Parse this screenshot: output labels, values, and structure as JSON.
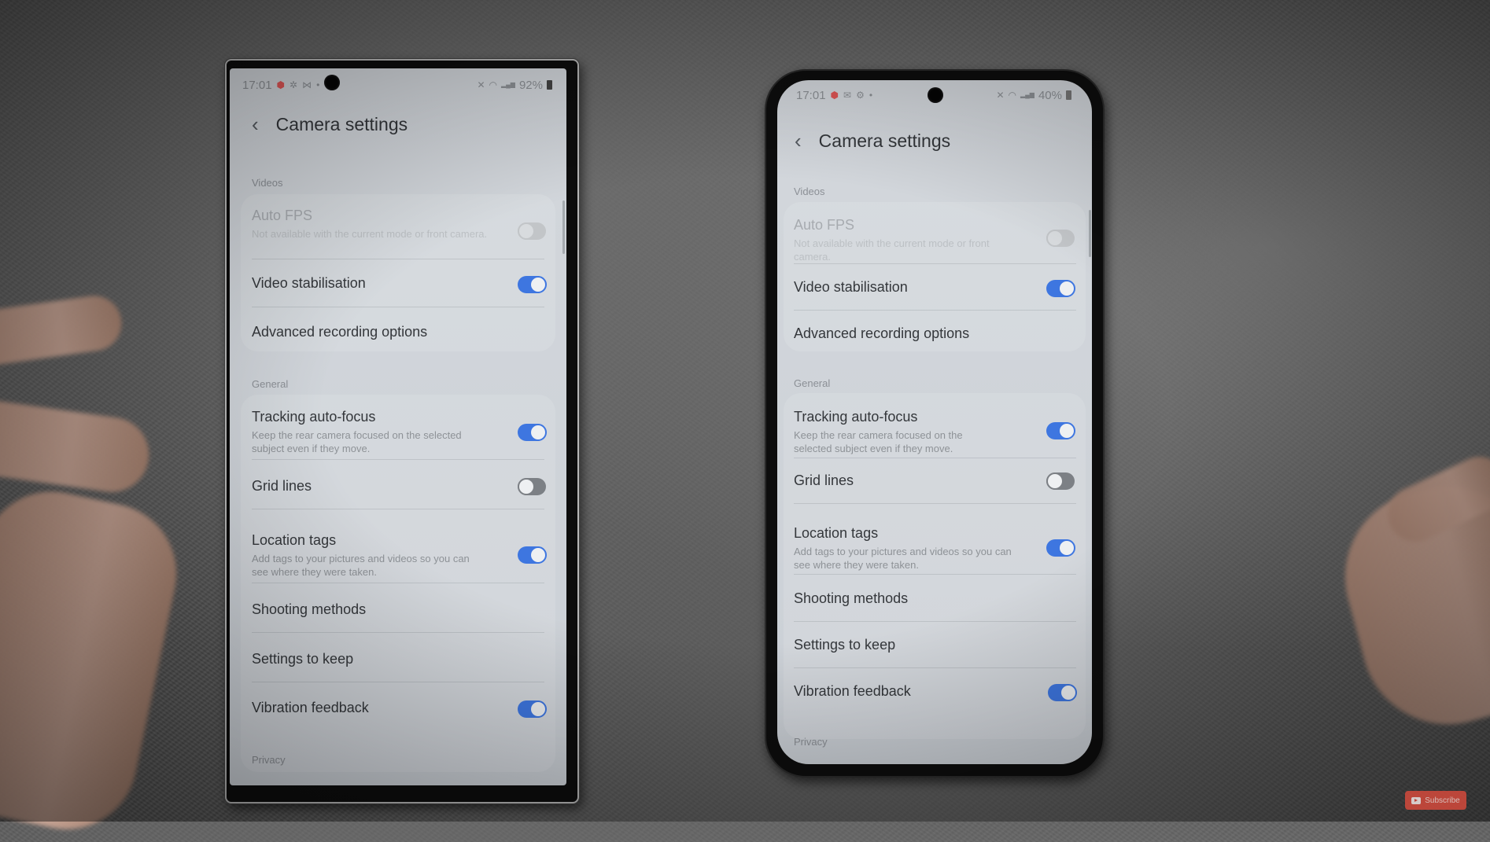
{
  "phones": {
    "left": {
      "status": {
        "time": "17:01",
        "battery": "92%",
        "icons_left": [
          "record-icon",
          "pinwheel-icon",
          "gmail-icon",
          "dot-icon"
        ],
        "icons_right": [
          "mute-icon",
          "wifi-icon",
          "signal-icon",
          "battery-icon"
        ]
      },
      "title": "Camera settings",
      "sections": [
        "Videos",
        "General",
        "Privacy"
      ],
      "items": [
        {
          "label": "Auto FPS",
          "sub": "Not available with the current mode or front camera.",
          "toggle": "disabled"
        },
        {
          "label": "Video stabilisation",
          "toggle": "on"
        },
        {
          "label": "Advanced recording options"
        },
        {
          "label": "Tracking auto-focus",
          "sub": "Keep the rear camera focused on the selected subject even if they move.",
          "toggle": "on"
        },
        {
          "label": "Grid lines",
          "toggle": "off"
        },
        {
          "label": "Location tags",
          "sub": "Add tags to your pictures and videos so you can see where they were taken.",
          "toggle": "on"
        },
        {
          "label": "Shooting methods"
        },
        {
          "label": "Settings to keep"
        },
        {
          "label": "Vibration feedback",
          "toggle": "on"
        }
      ]
    },
    "right": {
      "status": {
        "time": "17:01",
        "battery": "40%",
        "icons_left": [
          "record-icon",
          "mail-icon",
          "gear-icon",
          "dot-icon"
        ],
        "icons_right": [
          "mute-icon",
          "wifi-icon",
          "signal-icon",
          "battery-icon"
        ]
      },
      "title": "Camera settings",
      "sections": [
        "Videos",
        "General",
        "Privacy"
      ],
      "items": [
        {
          "label": "Auto FPS",
          "sub": "Not available with the current mode or front camera.",
          "toggle": "disabled"
        },
        {
          "label": "Video stabilisation",
          "toggle": "on"
        },
        {
          "label": "Advanced recording options"
        },
        {
          "label": "Tracking auto-focus",
          "sub": "Keep the rear camera focused on the selected subject even if they move.",
          "toggle": "on"
        },
        {
          "label": "Grid lines",
          "toggle": "off"
        },
        {
          "label": "Location tags",
          "sub": "Add tags to your pictures and videos so you can see where they were taken.",
          "toggle": "on"
        },
        {
          "label": "Shooting methods"
        },
        {
          "label": "Settings to keep"
        },
        {
          "label": "Vibration feedback",
          "toggle": "on"
        }
      ]
    }
  },
  "overlay": {
    "subscribe_label": "Subscribe"
  },
  "colors": {
    "toggle_on": "#3e76e0",
    "toggle_off": "#7c8085",
    "record_icon": "#e05656",
    "subscribe": "#d44a3c"
  },
  "glyphs": {
    "back": "‹",
    "record": "⬢",
    "pinwheel": "✲",
    "gmail": "⋈",
    "mail": "✉",
    "gear": "⚙",
    "dot": "•",
    "mute": "✕",
    "wifi": "◠",
    "signal": "▂▄▆"
  }
}
